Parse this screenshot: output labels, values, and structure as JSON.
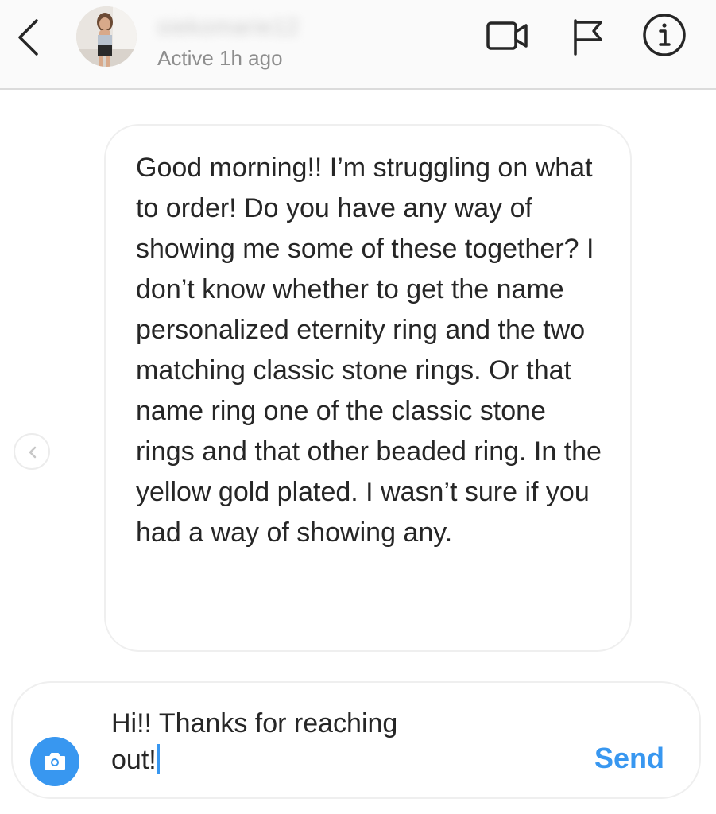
{
  "header": {
    "username": "siekomarie12",
    "status": "Active 1h ago",
    "icons": {
      "back": "chevron-left-icon",
      "video": "video-camera-icon",
      "flag": "flag-icon",
      "info": "info-icon"
    }
  },
  "conversation": {
    "received_message": "Good morning!! I’m struggling on what to order! Do you have any way of showing me some of these together? I don’t know whether to get the name personalized eternity ring and the two matching classic stone rings. Or that name ring one of the classic stone rings and that other beaded ring. In the yellow gold plated. I wasn’t sure if you had a way of showing any."
  },
  "composer": {
    "draft_line1": "Hi!! Thanks for reaching",
    "draft_line2": "out!",
    "send_label": "Send"
  },
  "colors": {
    "accent": "#3897f0",
    "text": "#262626",
    "muted": "#8e8e8e",
    "border": "#efefef"
  }
}
